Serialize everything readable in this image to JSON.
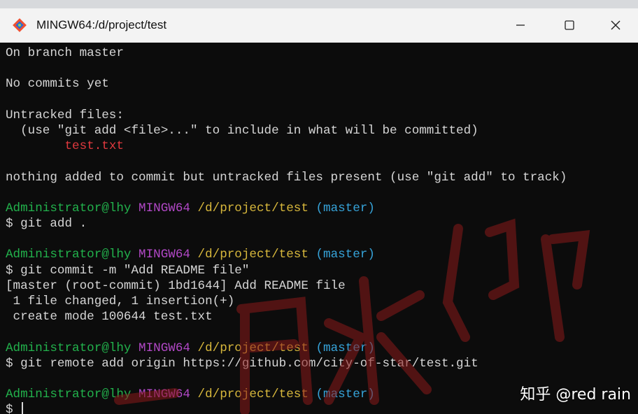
{
  "window": {
    "title": "MINGW64:/d/project/test",
    "app_icon": "git-diamond-icon",
    "controls": [
      "minimize-icon",
      "maximize-icon",
      "close-icon"
    ]
  },
  "terminal": {
    "lines": [
      [
        {
          "t": "On branch master",
          "c": "default"
        }
      ],
      [],
      [
        {
          "t": "No commits yet",
          "c": "default"
        }
      ],
      [],
      [
        {
          "t": "Untracked files:",
          "c": "default"
        }
      ],
      [
        {
          "t": "  (use \"git add <file>...\" to include in what will be committed)",
          "c": "default"
        }
      ],
      [
        {
          "t": "        ",
          "c": "default"
        },
        {
          "t": "test.txt",
          "c": "red"
        }
      ],
      [],
      [
        {
          "t": "nothing added to commit but untracked files present (use \"git add\" to track)",
          "c": "default"
        }
      ],
      [],
      [
        {
          "t": "Administrator@lhy ",
          "c": "green"
        },
        {
          "t": "MINGW64 ",
          "c": "magenta"
        },
        {
          "t": "/d/project/test ",
          "c": "yellow"
        },
        {
          "t": "(master)",
          "c": "cyan"
        }
      ],
      [
        {
          "t": "$ git add .",
          "c": "default"
        }
      ],
      [],
      [
        {
          "t": "Administrator@lhy ",
          "c": "green"
        },
        {
          "t": "MINGW64 ",
          "c": "magenta"
        },
        {
          "t": "/d/project/test ",
          "c": "yellow"
        },
        {
          "t": "(master)",
          "c": "cyan"
        }
      ],
      [
        {
          "t": "$ git commit -m \"Add README file\"",
          "c": "default"
        }
      ],
      [
        {
          "t": "[master (root-commit) 1bd1644] Add README file",
          "c": "default"
        }
      ],
      [
        {
          "t": " 1 file changed, 1 insertion(+)",
          "c": "default"
        }
      ],
      [
        {
          "t": " create mode 100644 test.txt",
          "c": "default"
        }
      ],
      [],
      [
        {
          "t": "Administrator@lhy ",
          "c": "green"
        },
        {
          "t": "MINGW64 ",
          "c": "magenta"
        },
        {
          "t": "/d/project/test ",
          "c": "yellow"
        },
        {
          "t": "(master)",
          "c": "cyan"
        }
      ],
      [
        {
          "t": "$ git remote add origin https://github.com/city-of-star/test.git",
          "c": "default"
        }
      ],
      [],
      [
        {
          "t": "Administrator@lhy ",
          "c": "green"
        },
        {
          "t": "MINGW64 ",
          "c": "magenta"
        },
        {
          "t": "/d/project/test ",
          "c": "yellow"
        },
        {
          "t": "(master)",
          "c": "cyan"
        }
      ],
      [
        {
          "t": "$ ",
          "c": "default"
        }
      ]
    ]
  },
  "colors": {
    "background": "#0c0c0c",
    "default": "#d6d6d6",
    "red": "#e0393e",
    "green": "#22b24c",
    "magenta": "#b148c6",
    "yellow": "#d8b83c",
    "cyan": "#36a3d9",
    "watermark": "#8b1a1a"
  },
  "watermark": {
    "text": "中国水印"
  },
  "overlay": {
    "zhihu_credit": "知乎 @red rain"
  }
}
